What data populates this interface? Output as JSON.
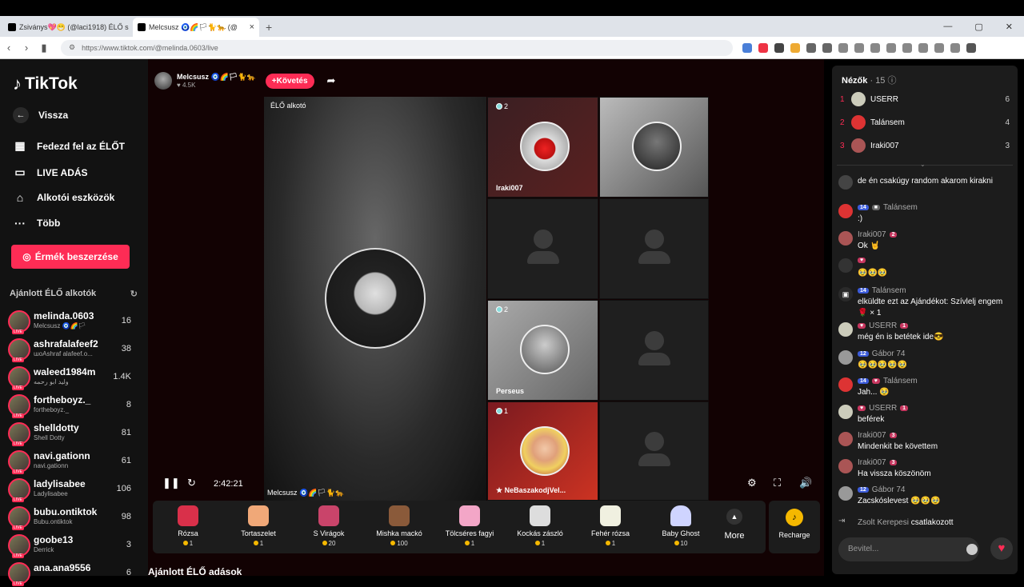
{
  "browser": {
    "tabs": [
      {
        "title": "Zsiványs💖😁 (@laci1918) ÉLŐ s",
        "close": "×"
      },
      {
        "title": "Melcsusz 🧿🌈🏳🐈🐆 (@",
        "close": "×"
      }
    ],
    "newtab": "+",
    "win": [
      "—",
      "▢",
      "✕"
    ],
    "url": "https://www.tiktok.com/@melinda.0603/live"
  },
  "sidebar": {
    "logo": "TikTok",
    "nav": [
      {
        "label": "Vissza",
        "icon": "back-arrow-icon"
      },
      {
        "label": "Fedezd fel az ÉLŐT",
        "icon": "calendar-icon"
      },
      {
        "label": "LIVE ADÁS",
        "icon": "camera-icon"
      },
      {
        "label": "Alkotói eszközök",
        "icon": "lightbulb-icon"
      },
      {
        "label": "Több",
        "icon": "more-icon"
      }
    ],
    "coin_button": "Érmék beszerzése",
    "suggested_header": "Ajánlott ÉLŐ alkotók",
    "creators": [
      {
        "name": "melinda.0603",
        "sub": "Melcsusz 🧿🌈🏳",
        "count": "16"
      },
      {
        "name": "ashrafalafeef2",
        "sub": "ɯoAshraf alafeef.o...",
        "count": "38"
      },
      {
        "name": "waleed1984m",
        "sub": "وليد ابو رحمه",
        "count": "1.4K"
      },
      {
        "name": "fortheboyz._",
        "sub": "fortheboyz._",
        "count": "8"
      },
      {
        "name": "shelldotty",
        "sub": "Shell Dotty",
        "count": "81"
      },
      {
        "name": "navi.gationn",
        "sub": "navi.gationn",
        "count": "61"
      },
      {
        "name": "ladylisabee",
        "sub": "Ladylisabee",
        "count": "106"
      },
      {
        "name": "bubu.ontiktok",
        "sub": "Bubu.ontiktok",
        "count": "98"
      },
      {
        "name": "goobe13",
        "sub": "Derrick",
        "count": "3"
      },
      {
        "name": "ana.ana9556",
        "sub": "",
        "count": "6"
      }
    ],
    "live_badge": "LIVE"
  },
  "stream": {
    "host_name": "Melcsusz 🧿🌈🏳🐈🐆",
    "host_likes": "♥ 4.5K",
    "follow": "+Követés",
    "host_label": "ÉLŐ alkotó",
    "guests": [
      {
        "name": "Iraki007",
        "score": "2"
      },
      {
        "name": "Perseus",
        "score": "2"
      },
      {
        "name": "★ NeBaszakodjVel...",
        "score": "1"
      }
    ],
    "timer": "2:42:21",
    "host_caption": "Melcsusz 🧿🌈🏳🐈🐆",
    "gifts": [
      {
        "name": "Rózsa",
        "price": "1",
        "color": "#d9304a"
      },
      {
        "name": "Tortaszelet",
        "price": "1",
        "color": "#f0a878"
      },
      {
        "name": "S Virágok",
        "price": "20",
        "color": "#c9446a"
      },
      {
        "name": "Mishka mackó",
        "price": "100",
        "color": "#8a5a3a"
      },
      {
        "name": "Tölcséres fagyi",
        "price": "1",
        "color": "#f3a6c7"
      },
      {
        "name": "Kockás zászló",
        "price": "1",
        "color": "#dddddd"
      },
      {
        "name": "Fehér rózsa",
        "price": "1",
        "color": "#f0f0e0"
      },
      {
        "name": "Baby Ghost",
        "price": "10",
        "color": "#cfd4ff"
      }
    ],
    "more": "More",
    "recharge": "Recharge",
    "recommended": "Ajánlott ÉLŐ adások"
  },
  "chat": {
    "viewers_label": "Nézők",
    "viewers_count": "· 15",
    "top": [
      {
        "rank": "1",
        "name": "USERR",
        "score": "6"
      },
      {
        "rank": "2",
        "name": "Talánsem",
        "score": "4"
      },
      {
        "rank": "3",
        "name": "Iraki007",
        "score": "3"
      }
    ],
    "messages": [
      {
        "user": "",
        "badge": "",
        "text": "de én csakúgy random akarom kirakni"
      },
      {
        "user": "Talánsem",
        "badge": "14",
        "text": ":)"
      },
      {
        "user": "Iraki007",
        "badge": "2",
        "text": "Ok 🤘"
      },
      {
        "user": "",
        "badge": "",
        "text": "🥹🥹🥹"
      },
      {
        "user": "Talánsem",
        "badge": "14",
        "text": "elküldte ezt az Ajándékot: Szívlelj engem 🌹 × 1"
      },
      {
        "user": "USERR",
        "badge": "1",
        "text": "még én is betétek ide😎"
      },
      {
        "user": "Gábor 74",
        "badge": "12",
        "text": "🥹🥹🥹🥹🥹"
      },
      {
        "user": "Talánsem",
        "badge": "14",
        "text": "Jah... 🥹"
      },
      {
        "user": "USERR",
        "badge": "1",
        "text": "beférek"
      },
      {
        "user": "Iraki007",
        "badge": "3",
        "text": "Mindenkit be követtem"
      },
      {
        "user": "Iraki007",
        "badge": "3",
        "text": "Ha vissza köszönöm"
      },
      {
        "user": "Gábor 74",
        "badge": "12",
        "text": "Zacskóslevest 🥹🥹🥹"
      },
      {
        "user": "Zsolt Kerepesi",
        "badge": "",
        "text": "csatlakozott"
      }
    ],
    "input_placeholder": "Bevitel...",
    "heart": "♥"
  }
}
